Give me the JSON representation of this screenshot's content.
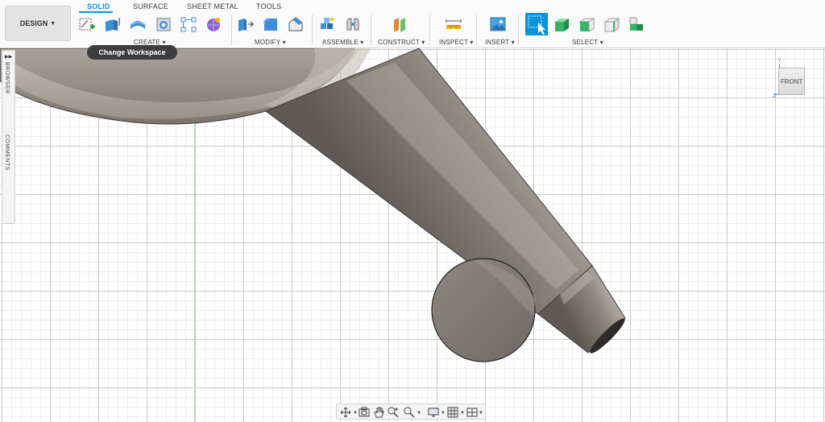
{
  "toolbar": {
    "workspace_label": "DESIGN",
    "tabs": [
      {
        "label": "SOLID",
        "active": true
      },
      {
        "label": "SURFACE",
        "active": false
      },
      {
        "label": "SHEET METAL",
        "active": false
      },
      {
        "label": "TOOLS",
        "active": false
      }
    ],
    "groups": {
      "create": "CREATE",
      "modify": "MODIFY",
      "assemble": "ASSEMBLE",
      "construct": "CONSTRUCT",
      "inspect": "INSPECT",
      "insert": "INSERT",
      "select": "SELECT"
    },
    "tooltip": "Change Workspace"
  },
  "side_panel": {
    "browser_label": "BROWSER",
    "comments_label": "COMMENTS"
  },
  "viewcube": {
    "face_label": "FRONT",
    "y_axis": "Y",
    "z_axis": "Z"
  },
  "colors": {
    "accent": "#0696d7",
    "model_metal": "#8a857c",
    "select_highlight": "#0696d7"
  },
  "icons": {
    "design_caret": "caret-down-icon",
    "create_sketch": "create-sketch-icon",
    "extrude": "extrude-icon",
    "revolve": "revolve-icon",
    "hole": "hole-icon",
    "rectangular_pattern": "pattern-icon",
    "form": "form-icon",
    "press_pull": "press-pull-icon",
    "fillet": "fillet-icon",
    "chamfer": "chamfer-icon",
    "new_component": "new-component-icon",
    "joint": "joint-icon",
    "offset_plane": "offset-plane-icon",
    "measure": "measure-icon",
    "insert_image": "insert-image-icon",
    "select_box": "select-box-icon",
    "select_body": "select-body-icon"
  }
}
